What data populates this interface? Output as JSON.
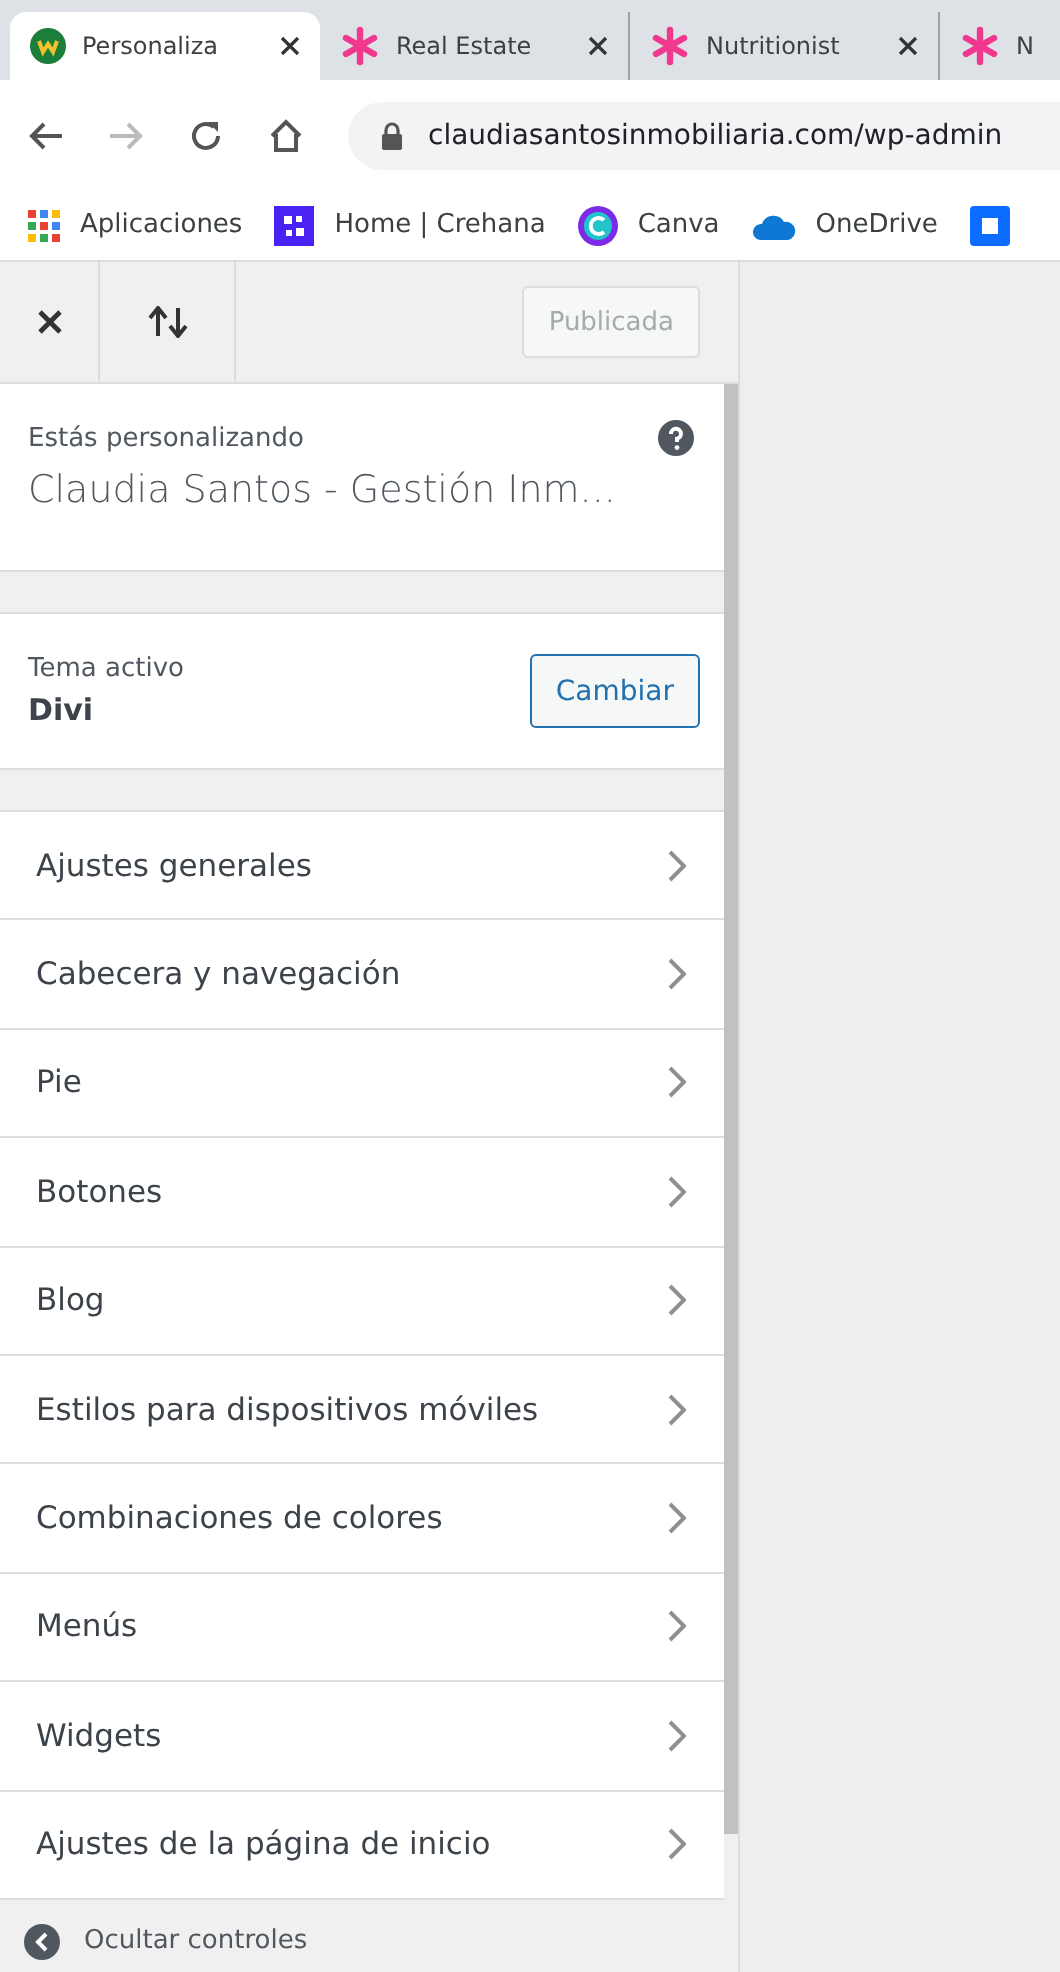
{
  "browser": {
    "tabs": [
      {
        "title": "Personaliza",
        "selected": true,
        "kind": "logo"
      },
      {
        "title": "Real Estate",
        "selected": false,
        "kind": "asterisk"
      },
      {
        "title": "Nutritionist",
        "selected": false,
        "kind": "asterisk"
      },
      {
        "title": "N",
        "selected": false,
        "kind": "asterisk"
      }
    ],
    "url": "claudiasantosinmobiliaria.com/wp-admin",
    "bookmarks": [
      {
        "label": "Aplicaciones",
        "kind": "apps"
      },
      {
        "label": "Home | Crehana",
        "kind": "square"
      },
      {
        "label": "Canva",
        "kind": "circle"
      },
      {
        "label": "OneDrive",
        "kind": "cloud"
      },
      {
        "kind": "tile"
      }
    ]
  },
  "customizer": {
    "publish_button": "Publicada",
    "publish_disabled": true,
    "customizing_label": "Estás personalizando",
    "site_title": "Claudia Santos - Gestión Inm...",
    "theme_label": "Tema activo",
    "theme_name": "Divi",
    "change_button": "Cambiar",
    "sections": [
      "Ajustes generales",
      "Cabecera y navegación",
      "Pie",
      "Botones",
      "Blog",
      "Estilos para dispositivos móviles",
      "Combinaciones de colores",
      "Menús",
      "Widgets",
      "Ajustes de la página de inicio"
    ],
    "footer": "Ocultar controles"
  }
}
